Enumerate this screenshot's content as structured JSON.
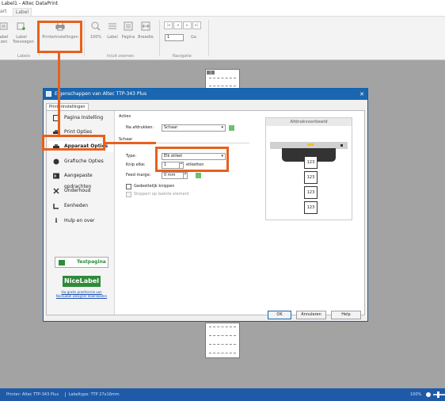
{
  "window": {
    "title": "Label1 - Altec DataPrint"
  },
  "tabs": [
    "art",
    "Label"
  ],
  "ribbon": {
    "buttons": {
      "label_sizes": "abel\nzen",
      "label_add": "Label\nToevoegen",
      "printer_settings": "Printerinstellingen",
      "zoom_100": "100%",
      "zoom_label": "Label",
      "zoom_page": "Pagina",
      "zoom_width": "Breedte",
      "nav_value": "1",
      "nav_go": "Ga"
    },
    "groups": {
      "labels": "Labels",
      "zoom": "In/uit zoomen",
      "nav": "Navigatie"
    }
  },
  "canvas": {
    "page_number": "1"
  },
  "dialog": {
    "title": "Eigenschappen van Altec TTP-343 Plus",
    "tab": "Printerinstellingen",
    "sidebar": [
      {
        "label": "Pagina Instelling",
        "icon": "page-setup-icon"
      },
      {
        "label": "Print Opties",
        "icon": "printer-icon"
      },
      {
        "label": "Apparaat Opties",
        "icon": "printer-device-icon"
      },
      {
        "label": "Grafische Opties",
        "icon": "graphics-icon"
      },
      {
        "label": "Aangepaste opdrachten",
        "icon": "terminal-icon"
      },
      {
        "label": "Onderhoud",
        "icon": "tools-icon"
      },
      {
        "label": "Eenheden",
        "icon": "ruler-icon"
      },
      {
        "label": "Hulp en over",
        "icon": "info-icon"
      }
    ],
    "testprint": "Testpagina",
    "brand": "NiceLabel",
    "promo_link": "Uw gratis proefversie van NiceLabel Designer downloaden",
    "actions": {
      "heading": "Acties",
      "after_print_label": "Na afdrukken:",
      "after_print_value": "Schaar"
    },
    "cutter": {
      "heading": "Schaar",
      "type_label": "Type:",
      "type_value": "Elk etiket",
      "cut_each_label": "Knip elke:",
      "cut_each_value": "1",
      "cut_each_unit": "etiketten",
      "feed_label": "Feed marge:",
      "feed_value": "0 mm",
      "reverse_cut": "Gedeeltelijk knippen",
      "stopper": "Stopperi op laatste element"
    },
    "preview": {
      "title": "Afdrukvoorbeeld",
      "label_text": "123"
    },
    "buttons": {
      "ok": "OK",
      "cancel": "Annuleren",
      "help": "Help"
    }
  },
  "status": {
    "printer": "Printer:  Altec TTP-343 Plus",
    "labeltype": "Labeltype:  TTP 27x16mm",
    "zoom": "100%"
  },
  "colors": {
    "accent": "#e8601c",
    "dialog_title": "#1a66b0",
    "statusbar": "#1e5aa8",
    "brand": "#2e8b3a"
  }
}
